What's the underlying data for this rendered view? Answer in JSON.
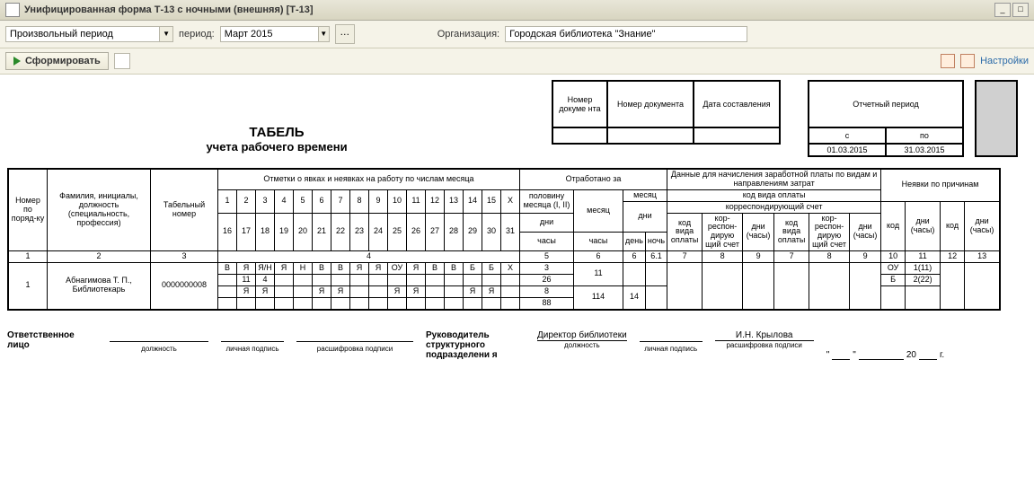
{
  "window": {
    "title": "Унифицированная форма Т-13 с ночными (внешняя) [Т-13]"
  },
  "toolbar": {
    "period_mode": "Произвольный период",
    "period_lbl": "период:",
    "period_val": "Март 2015",
    "org_lbl": "Организация:",
    "org_val": "Городская библиотека \"Знание\"",
    "form_btn": "Сформировать",
    "settings": "Настройки"
  },
  "doc": {
    "title": "ТАБЕЛЬ",
    "subtitle": "учета  рабочего времени",
    "hdr": {
      "doc_num_lbl1": "Номер докуме нта",
      "doc_num_lbl2": "Номер документа",
      "date_lbl": "Дата составления",
      "report_period_lbl": "Отчетный период",
      "from": "с",
      "to": "по",
      "from_val": "01.03.2015",
      "to_val": "31.03.2015"
    },
    "cols": {
      "c1": "Номер по поряд-ку",
      "c2": "Фамилия, инициалы, должность (специальность, профессия)",
      "c3": "Табельный номер",
      "marks": "Отметки о явках и неявках на работу по числам месяца",
      "worked": "Отработано за",
      "half": "половину месяца (I, II)",
      "month": "месяц",
      "days": "дни",
      "hours": "часы",
      "day": "день",
      "night": "ночь",
      "pay": "Данные для начисления заработной платы по видам и направлениям затрат",
      "paycode": "код вида оплаты",
      "korr": "корреспондирующий счет",
      "kod_vida": "код вида оплаты",
      "korr_schet": "кор-респон-дирую щий счет",
      "dni_chasy": "дни (часы)",
      "absent": "Неявки по причинам",
      "kod": "код",
      "nums": [
        "1",
        "2",
        "3",
        "4",
        "5",
        "6",
        "7",
        "8",
        "9",
        "10",
        "11",
        "12",
        "13",
        "14",
        "15",
        "X"
      ],
      "nums2": [
        "16",
        "17",
        "18",
        "19",
        "20",
        "21",
        "22",
        "23",
        "24",
        "25",
        "26",
        "27",
        "28",
        "29",
        "30",
        "31"
      ],
      "num_row": [
        "1",
        "2",
        "3",
        "4",
        "5",
        "6",
        "6.1",
        "7",
        "8",
        "9",
        "7",
        "8",
        "9",
        "10",
        "11",
        "12",
        "13"
      ]
    },
    "row": {
      "n": "1",
      "fio": "Абнагимова Т. П., Библиотекарь",
      "tabnum": "0000000008",
      "marks1": [
        "В",
        "Я",
        "Я/Н",
        "Я",
        "Н",
        "В",
        "В",
        "Я",
        "Я",
        "ОУ",
        "Я",
        "В",
        "В",
        "Б",
        "Б",
        "Х"
      ],
      "marks1b": [
        "",
        "11",
        "4",
        "",
        "",
        "",
        "",
        "",
        "",
        "",
        "",
        "",
        "",
        "",
        "",
        ""
      ],
      "marks2": [
        "",
        "Я",
        "Я",
        "",
        "",
        "Я",
        "Я",
        "",
        "",
        "Я",
        "Я",
        "",
        "",
        "Я",
        "Я",
        ""
      ],
      "marks2b": [
        "",
        "",
        "",
        "",
        "",
        "",
        "",
        "",
        "",
        "",
        "",
        "",
        "",
        "",
        "",
        ""
      ],
      "half_vals": [
        "3",
        "26",
        "8",
        "88"
      ],
      "month_total": "11",
      "month_hours": "114",
      "month_night": "14",
      "abs": [
        [
          "ОУ",
          "1(11)"
        ],
        [
          "Б",
          "2(22)"
        ]
      ]
    },
    "sig": {
      "resp": "Ответственное лицо",
      "dolzh": "должность",
      "lpodpis": "личная подпись",
      "rasshifr": "расшифровка подписи",
      "ruk": "Руководитель структурного подразделени я",
      "dir": "Директор библиотеки",
      "fio": "И.Н. Крылова",
      "y": "20",
      "g": "г."
    }
  }
}
